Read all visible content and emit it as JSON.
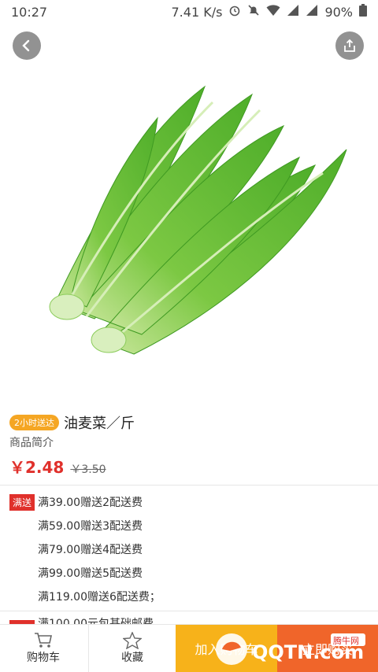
{
  "status": {
    "time": "10:27",
    "speed": "7.41 K/s",
    "battery": "90%",
    "icons": [
      "alarm-icon",
      "mute-icon",
      "wifi-icon",
      "signal-icon",
      "signal-icon",
      "battery-icon"
    ]
  },
  "nav": {
    "back_icon": "chevron-left-icon",
    "share_icon": "share-icon"
  },
  "product": {
    "badge": "2小时送达",
    "title": "油麦菜／斤",
    "intro": "商品简介",
    "price": "￥2.48",
    "original_price": "￥3.50"
  },
  "promotions": {
    "tag": "满送",
    "lines": [
      "满39.00赠送2配送费",
      "满59.00赠送3配送费",
      "满79.00赠送4配送费",
      "满99.00赠送5配送费",
      "满119.00赠送6配送费；"
    ],
    "next_partial": "满100.00元包基础邮费"
  },
  "bottom": {
    "cart_label": "购物车",
    "favorite_label": "收藏",
    "add_cart_label": "加入购物车",
    "buy_now_label": "立即购买"
  },
  "watermark": {
    "brand": "QQTN.com",
    "sub": "腾牛网"
  },
  "colors": {
    "price_red": "#e0302b",
    "badge_orange": "#f5a623",
    "add_cart_bg": "#f7b21a",
    "buy_now_bg": "#f0652a"
  }
}
